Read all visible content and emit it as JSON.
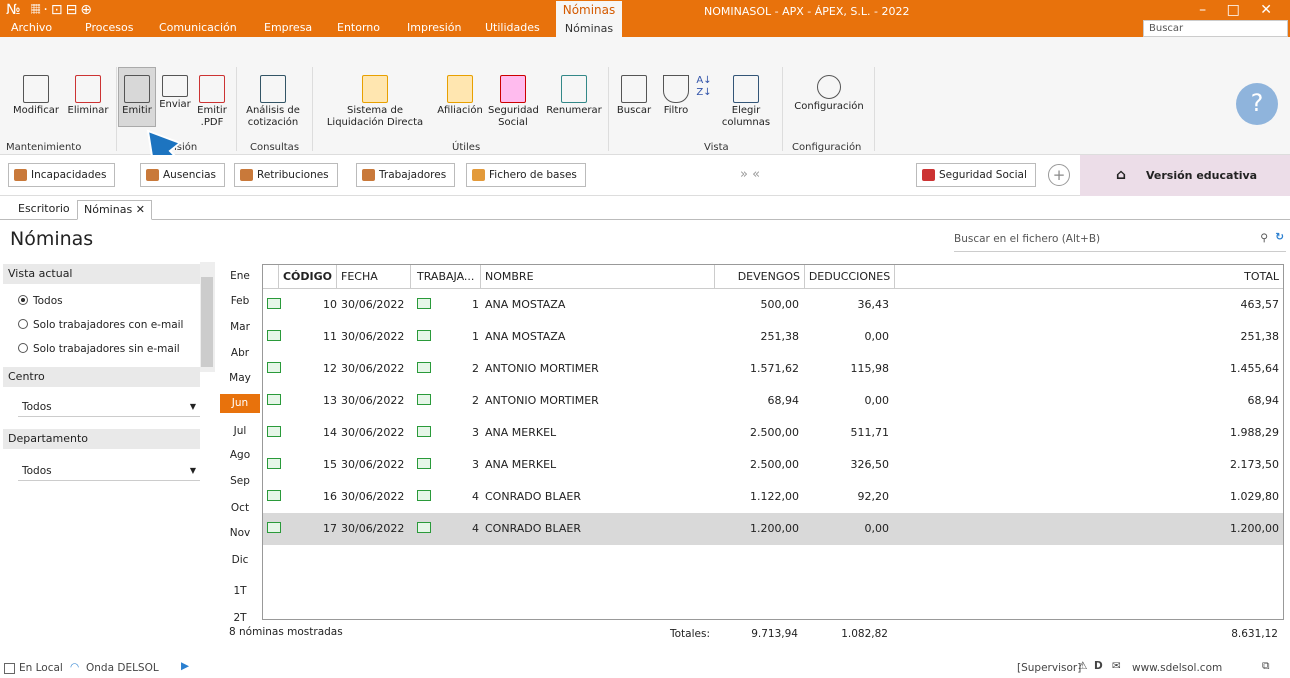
{
  "window": {
    "title": "NOMINASOL - APX - ÁPEX, S.L. - 2022",
    "context_tab": "Nóminas",
    "quick_access": "№ 𝄜·⊡⊟⊕"
  },
  "menu": [
    "Archivo",
    "Procesos",
    "Comunicación",
    "Empresa",
    "Entorno",
    "Impresión",
    "Utilidades"
  ],
  "menu_active": "Nóminas",
  "search_top": "Buscar",
  "ribbon": {
    "buttons": [
      "Modificar",
      "Eliminar",
      "Emitir",
      "Enviar",
      "Emitir .PDF",
      "Análisis de cotización",
      "Sistema de Liquidación Directa",
      "Afiliación",
      "Seguridad Social",
      "Renumerar",
      "Buscar",
      "Filtro",
      "Elegir columnas",
      "Configuración"
    ],
    "groups": [
      "Mantenimiento",
      "isión",
      "Consultas",
      "Útiles",
      "Vista",
      "Configuración"
    ]
  },
  "shortcuts": [
    "Incapacidades",
    "Ausencias",
    "Retribuciones",
    "Trabajadores",
    "Fichero de bases",
    "Seguridad Social"
  ],
  "shortcuts_nav": "» «",
  "edu_label": "Versión educativa",
  "tabs": [
    "Escritorio",
    "Nóminas"
  ],
  "page_title": "Nóminas",
  "file_search": "Buscar en el fichero (Alt+B)",
  "left": {
    "view_title": "Vista actual",
    "options": [
      "Todos",
      "Solo trabajadores con e-mail",
      "Solo trabajadores sin e-mail"
    ],
    "centro_title": "Centro",
    "centro_value": "Todos",
    "depto_title": "Departamento",
    "depto_value": "Todos"
  },
  "months": [
    "Ene",
    "Feb",
    "Mar",
    "Abr",
    "May",
    "Jun",
    "Jul",
    "Ago",
    "Sep",
    "Oct",
    "Nov",
    "Dic",
    "1T",
    "2T"
  ],
  "columns": [
    "CÓDIGO",
    "FECHA",
    "TRABAJA...",
    "NOMBRE",
    "DEVENGOS",
    "DEDUCCIONES",
    "TOTAL"
  ],
  "rows": [
    {
      "codigo": "10",
      "fecha": "30/06/2022",
      "trab": "1",
      "nombre": "ANA MOSTAZA",
      "dev": "500,00",
      "ded": "36,43",
      "total": "463,57"
    },
    {
      "codigo": "11",
      "fecha": "30/06/2022",
      "trab": "1",
      "nombre": "ANA MOSTAZA",
      "dev": "251,38",
      "ded": "0,00",
      "total": "251,38"
    },
    {
      "codigo": "12",
      "fecha": "30/06/2022",
      "trab": "2",
      "nombre": "ANTONIO MORTIMER",
      "dev": "1.571,62",
      "ded": "115,98",
      "total": "1.455,64"
    },
    {
      "codigo": "13",
      "fecha": "30/06/2022",
      "trab": "2",
      "nombre": "ANTONIO MORTIMER",
      "dev": "68,94",
      "ded": "0,00",
      "total": "68,94"
    },
    {
      "codigo": "14",
      "fecha": "30/06/2022",
      "trab": "3",
      "nombre": "ANA MERKEL",
      "dev": "2.500,00",
      "ded": "511,71",
      "total": "1.988,29"
    },
    {
      "codigo": "15",
      "fecha": "30/06/2022",
      "trab": "3",
      "nombre": "ANA MERKEL",
      "dev": "2.500,00",
      "ded": "326,50",
      "total": "2.173,50"
    },
    {
      "codigo": "16",
      "fecha": "30/06/2022",
      "trab": "4",
      "nombre": "CONRADO BLAER",
      "dev": "1.122,00",
      "ded": "92,20",
      "total": "1.029,80"
    },
    {
      "codigo": "17",
      "fecha": "30/06/2022",
      "trab": "4",
      "nombre": "CONRADO BLAER",
      "dev": "1.200,00",
      "ded": "0,00",
      "total": "1.200,00"
    }
  ],
  "footer": {
    "count": "8 nóminas mostradas",
    "totals_label": "Totales:",
    "dev": "9.713,94",
    "ded": "1.082,82",
    "total": "8.631,12"
  },
  "status": {
    "local": "En Local",
    "onda": "Onda DELSOL",
    "right": "[Supervisor]",
    "site": "www.sdelsol.com"
  }
}
